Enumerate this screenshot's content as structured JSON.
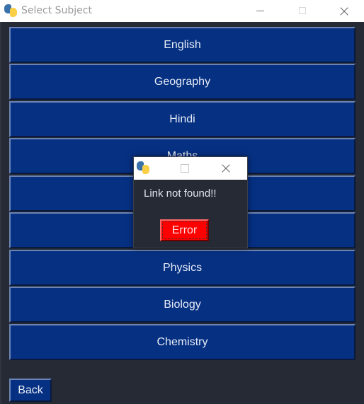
{
  "window": {
    "title": "Select Subject",
    "controls": [
      "minimize",
      "maximize",
      "close"
    ]
  },
  "subjects": [
    {
      "label": "English"
    },
    {
      "label": "Geography"
    },
    {
      "label": "Hindi"
    },
    {
      "label": "Maths"
    },
    {
      "label": ""
    },
    {
      "label": ""
    },
    {
      "label": "Physics"
    },
    {
      "label": "Biology"
    },
    {
      "label": "Chemistry"
    }
  ],
  "back_label": "Back",
  "dialog": {
    "title": "",
    "message": "Link not found!!",
    "button_label": "Error",
    "button_color": "#ff0000"
  },
  "colors": {
    "background": "#252a35",
    "button_bg": "#063082",
    "button_text": "#e6ecf6"
  }
}
